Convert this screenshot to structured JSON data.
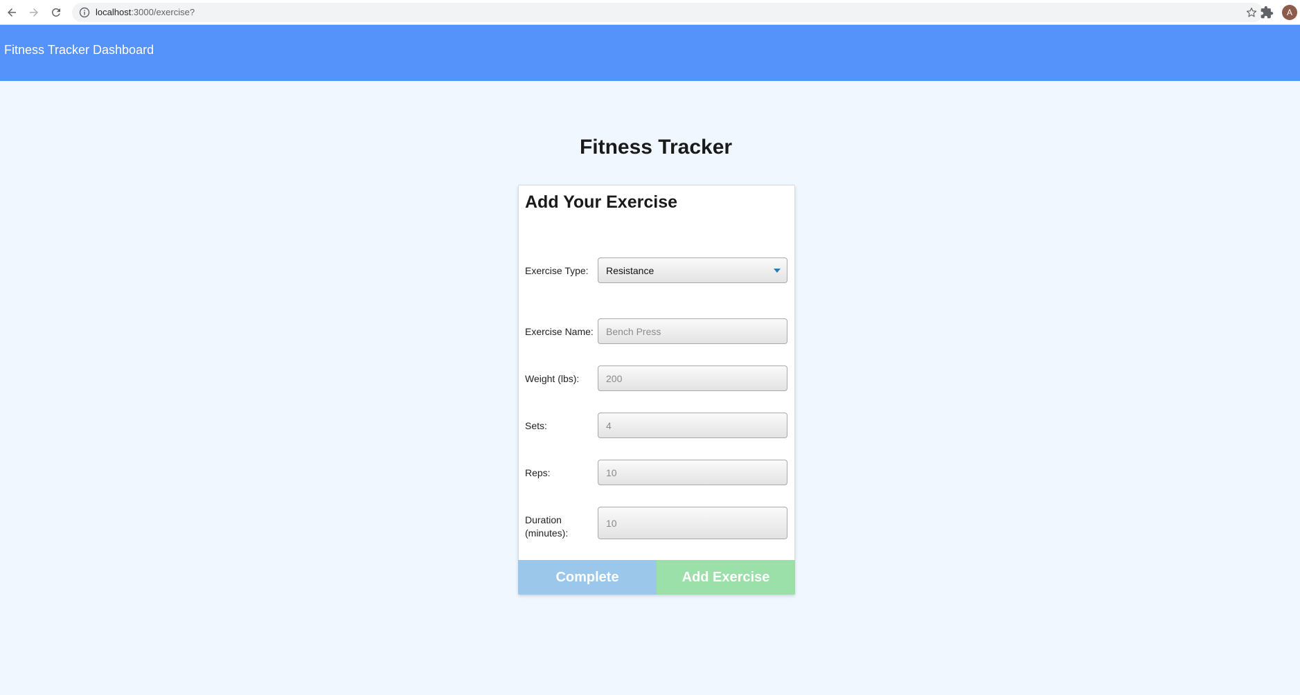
{
  "browser": {
    "url_host": "localhost",
    "url_path": ":3000/exercise?",
    "avatar_letter": "A"
  },
  "header": {
    "brand": "Fitness Tracker Dashboard",
    "color": "#5592fa"
  },
  "page": {
    "title": "Fitness Tracker",
    "background": "#f0f7ff"
  },
  "form": {
    "heading": "Add Your Exercise",
    "exercise_type": {
      "label": "Exercise Type:",
      "value": "Resistance"
    },
    "exercise_name": {
      "label": "Exercise Name:",
      "placeholder": "Bench Press"
    },
    "weight": {
      "label": "Weight (lbs):",
      "placeholder": "200"
    },
    "sets": {
      "label": "Sets:",
      "placeholder": "4"
    },
    "reps": {
      "label": "Reps:",
      "placeholder": "10"
    },
    "duration": {
      "label": "Duration (minutes):",
      "placeholder": "10"
    },
    "buttons": {
      "complete": "Complete",
      "add": "Add Exercise",
      "complete_color": "#9bc7ea",
      "add_color": "#9bdfa9"
    }
  },
  "icons": [
    "back-arrow-icon",
    "forward-arrow-icon",
    "reload-icon",
    "info-icon",
    "star-icon",
    "puzzle-icon",
    "chevron-down-icon"
  ]
}
